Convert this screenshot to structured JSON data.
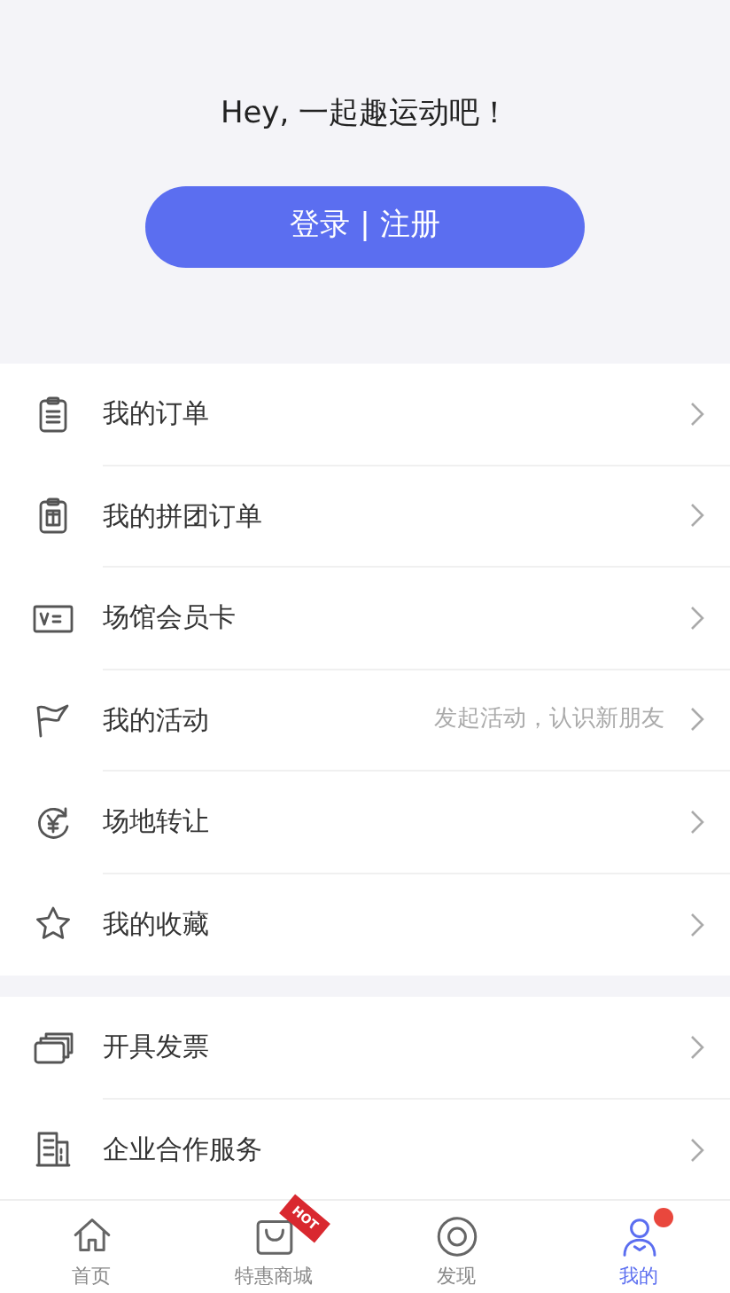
{
  "header": {
    "greeting": "Hey, 一起趣运动吧！",
    "login_button": "登录 | 注册"
  },
  "menu_groups": [
    {
      "items": [
        {
          "label": "我的订单"
        },
        {
          "label": "我的拼团订单"
        },
        {
          "label": "场馆会员卡"
        },
        {
          "label": "我的活动",
          "hint": "发起活动，认识新朋友"
        },
        {
          "label": "场地转让"
        },
        {
          "label": "我的收藏"
        }
      ]
    },
    {
      "items": [
        {
          "label": "开具发票"
        },
        {
          "label": "企业合作服务"
        }
      ]
    }
  ],
  "tab_bar": [
    {
      "label": "首页",
      "selected": false
    },
    {
      "label": "特惠商城",
      "selected": false,
      "tag": "HOT"
    },
    {
      "label": "发现",
      "selected": false
    },
    {
      "label": "我的",
      "selected": true,
      "dot": true
    }
  ]
}
